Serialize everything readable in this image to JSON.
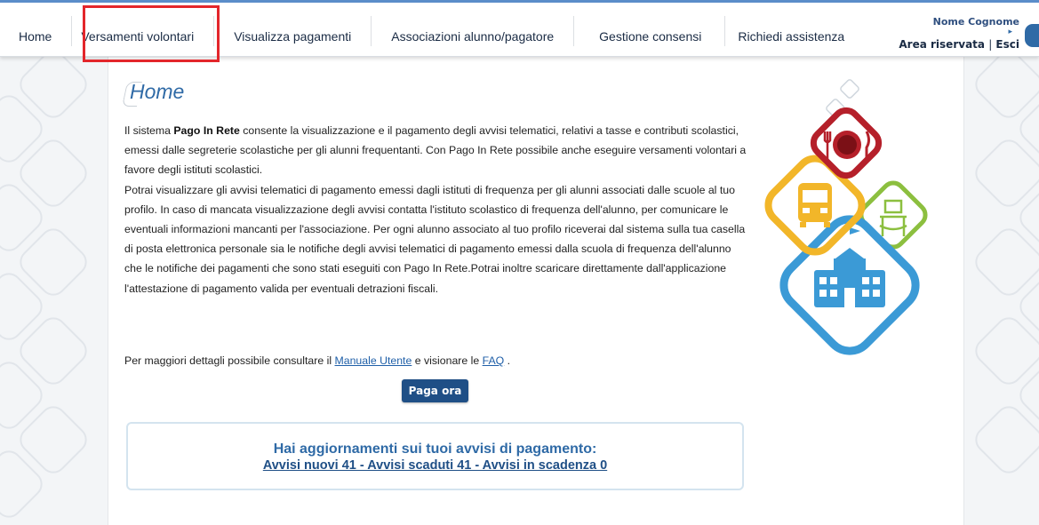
{
  "nav": {
    "items": [
      {
        "label": "Home"
      },
      {
        "label": "Versamenti volontari"
      },
      {
        "label": "Visualizza pagamenti"
      },
      {
        "label": "Associazioni alunno/pagatore"
      },
      {
        "label": "Gestione consensi"
      },
      {
        "label": "Richiedi assistenza"
      }
    ],
    "highlighted": "Versamenti volontari",
    "highlight_color": "#e3262b"
  },
  "user": {
    "name": "Nome Cognome",
    "area_label": "Area riservata",
    "separator": "|",
    "logout_label": "Esci"
  },
  "page": {
    "title": "Home",
    "intro_prefix": "Il sistema ",
    "intro_brand": "Pago In Rete",
    "intro_rest": " consente la visualizzazione e il pagamento degli avvisi telematici, relativi a tasse e contributi scolastici, emessi dalle segreterie scolastiche per gli alunni frequentanti. Con Pago In Rete possibile anche eseguire versamenti volontari a favore degli istituti scolastici.",
    "paragraph2": "Potrai visualizzare gli avvisi telematici di pagamento emessi dagli istituti di frequenza per gli alunni associati dalle scuole al tuo profilo. In caso di mancata visualizzazione degli avvisi contatta l'istituto scolastico di frequenza dell'alunno, per comunicare le eventuali informazioni mancanti per l'associazione. Per ogni alunno associato al tuo profilo riceverai dal sistema sulla tua casella di posta elettronica personale sia le notifiche degli avvisi telematici di pagamento emessi dalla scuola di frequenza dell'alunno che le notifiche dei pagamenti che sono stati eseguiti con Pago In Rete.Potrai inoltre scaricare direttamente dall'applicazione l'attestazione di pagamento valida per eventuali detrazioni fiscali.",
    "details_prefix": "Per maggiori dettagli possibile consultare il ",
    "manual_link": "Manuale Utente",
    "details_middle": " e visionare le ",
    "faq_link": "FAQ",
    "details_suffix": " .",
    "pay_button": "Paga ora"
  },
  "notice": {
    "title": "Hai aggiornamenti sui tuoi avvisi di pagamento:",
    "link": "Avvisi nuovi 41 - Avvisi scaduti 41 - Avvisi in scadenza 0"
  },
  "colors": {
    "accent_blue": "#2f6aa6",
    "button_bg": "#1f4f86",
    "illustration_red": "#b5202a",
    "illustration_yellow": "#f2b629",
    "illustration_green": "#8cbf3f",
    "illustration_blue": "#3b9ad6"
  },
  "icons": [
    "dining-icon",
    "school-bus-icon",
    "fence-icon",
    "school-building-icon"
  ]
}
